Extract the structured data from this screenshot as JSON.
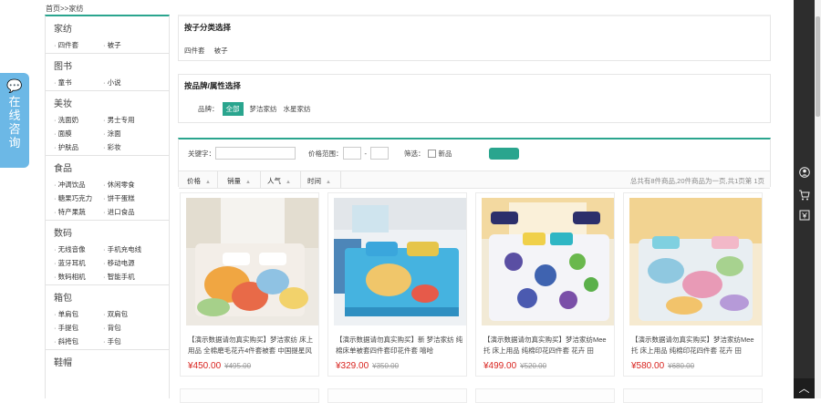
{
  "breadcrumb": "首页>>家纺",
  "consult": {
    "label": "在线咨询"
  },
  "sidebar": {
    "categories": [
      {
        "title": "家纺",
        "items": [
          "四件套",
          "被子"
        ]
      },
      {
        "title": "图书",
        "items": [
          "童书",
          "小说"
        ]
      },
      {
        "title": "美妆",
        "items": [
          "洗面奶",
          "男士专用",
          "面膜",
          "涂面",
          "护肤品",
          "彩妆"
        ]
      },
      {
        "title": "食品",
        "items": [
          "冲调饮品",
          "休闲零食",
          "糖果巧克力",
          "饼干蛋糕",
          "特产果蔬",
          "进口食品"
        ]
      },
      {
        "title": "数码",
        "items": [
          "无线音像",
          "手机充电线",
          "蓝牙耳机",
          "移动电源",
          "数码相机",
          "智能手机"
        ]
      },
      {
        "title": "箱包",
        "items": [
          "单肩包",
          "双肩包",
          "手提包",
          "背包",
          "斜挎包",
          "手包"
        ]
      },
      {
        "title": "鞋帽",
        "items": []
      }
    ]
  },
  "subcategory": {
    "title": "按子分类选择",
    "items": [
      "四件套",
      "被子"
    ]
  },
  "brand": {
    "title": "按品牌/属性选择",
    "label": "品牌：",
    "options": [
      "全部",
      "梦洁家纺",
      "水星家纺"
    ]
  },
  "filter": {
    "keyword_label": "关键字：",
    "price_label": "价格范围：",
    "price_sep": "-",
    "screen_label": "筛选：",
    "new_label": "新品",
    "sort": [
      "价格",
      "销量",
      "人气",
      "时间"
    ],
    "result_info": "总共有8件商品,20件商品为一页,共1页第 1页"
  },
  "products": [
    {
      "name": "【演示数据请勿真实购买】梦洁家纺 床上用品 全棉磨毛花卉4件套被套 中国提星风",
      "price": "¥450.00",
      "old_price": "¥495.00"
    },
    {
      "name": "【演示数据请勿真实购买】新 梦洁家纺 纯棉床单被套四件套印花件套 嘻哈",
      "price": "¥329.00",
      "old_price": "¥350.00"
    },
    {
      "name": "【演示数据请勿真实购买】梦洁家纺Mee托 床上用品 纯棉印花四件套 花卉 田",
      "price": "¥499.00",
      "old_price": "¥520.00"
    },
    {
      "name": "【演示数据请勿真实购买】梦洁家纺Mee托 床上用品 纯棉印花四件套 花卉 田",
      "price": "¥580.00",
      "old_price": "¥680.00"
    }
  ],
  "colors": {
    "accent": "#2aa58e",
    "price": "#d8231e",
    "consult": "#6cb8e6"
  }
}
